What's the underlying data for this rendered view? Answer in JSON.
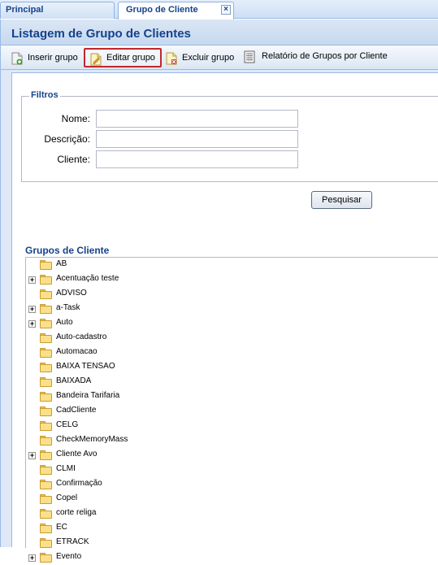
{
  "tabs": [
    {
      "label": "Principal"
    },
    {
      "label": "Grupo de Cliente"
    }
  ],
  "panel": {
    "title": "Listagem de Grupo de Clientes"
  },
  "toolbar": {
    "inserir": {
      "label": "Inserir grupo",
      "icon": "add-document-icon"
    },
    "editar": {
      "label": "Editar grupo",
      "icon": "edit-document-icon"
    },
    "excluir": {
      "label": "Excluir grupo",
      "icon": "delete-document-icon"
    },
    "relatorio": {
      "label": "Relatório de Grupos por Cliente",
      "icon": "report-icon"
    }
  },
  "filtros": {
    "legend": "Filtros",
    "fields": [
      {
        "label": "Nome:",
        "value": ""
      },
      {
        "label": "Descrição:",
        "value": ""
      },
      {
        "label": "Cliente:",
        "value": ""
      }
    ]
  },
  "search_button": "Pesquisar",
  "grupos": {
    "title": "Grupos de Cliente",
    "items": [
      {
        "label": "AB",
        "expandable": false
      },
      {
        "label": "Acentuação teste",
        "expandable": true
      },
      {
        "label": "ADVISO",
        "expandable": false
      },
      {
        "label": "a-Task",
        "expandable": true
      },
      {
        "label": "Auto",
        "expandable": true
      },
      {
        "label": "Auto-cadastro",
        "expandable": false
      },
      {
        "label": "Automacao",
        "expandable": false
      },
      {
        "label": "BAIXA TENSAO",
        "expandable": false
      },
      {
        "label": "BAIXADA",
        "expandable": false
      },
      {
        "label": "Bandeira Tarifaria",
        "expandable": false
      },
      {
        "label": "CadCliente",
        "expandable": false
      },
      {
        "label": "CELG",
        "expandable": false
      },
      {
        "label": "CheckMemoryMass",
        "expandable": false
      },
      {
        "label": "Cliente Avo",
        "expandable": true
      },
      {
        "label": "CLMI",
        "expandable": false
      },
      {
        "label": "Confirmação",
        "expandable": false
      },
      {
        "label": "Copel",
        "expandable": false
      },
      {
        "label": "corte religa",
        "expandable": false
      },
      {
        "label": "EC",
        "expandable": false
      },
      {
        "label": "ETRACK",
        "expandable": false
      },
      {
        "label": "Evento",
        "expandable": true
      }
    ]
  },
  "colors": {
    "accent": "#15428b",
    "highlight_border": "#c0282d"
  }
}
